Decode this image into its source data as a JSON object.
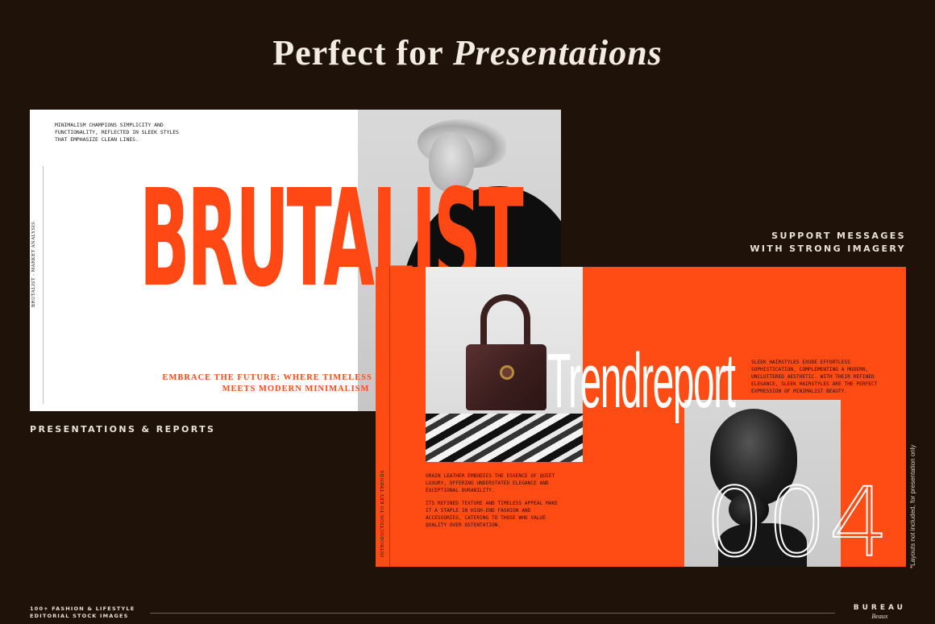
{
  "heading": {
    "plain": "Perfect for ",
    "italic": "Presentations"
  },
  "captions": {
    "left": "PRESENTATIONS & REPORTS",
    "right_line1": "SUPPORT MESSAGES",
    "right_line2": "WITH STRONG IMAGERY"
  },
  "slide1": {
    "intro": "MINIMALISM CHAMPIONS SIMPLICITY AND FUNCTIONALITY, REFLECTED IN SLEEK STYLES THAT EMPHASIZE CLEAN LINES.",
    "title": "BRUTALIST",
    "tagline_line1": "EMBRACE THE FUTURE: WHERE TIMELESS ELEGANCE",
    "tagline_line2": "MEETS MODERN MINIMALISM",
    "vertical_label": "BRUTALIST - MARKET ANALYSIS"
  },
  "slide2": {
    "title": "Trendreport",
    "description": "SLEEK HAIRSTYLES EXUDE EFFORTLESS SOPHISTICATION, COMPLEMENTING A MODERN, UNCLUTTERED AESTHETIC. WITH THEIR REFINED ELEGANCE, SLEEK HAIRSTYLES ARE THE PERFECT EXPRESSION OF MINIMALIST BEAUTY.",
    "body_p1": "GRAIN LEATHER EMBODIES THE ESSENCE OF QUIET LUXURY, OFFERING UNDERSTATED ELEGANCE AND EXCEPTIONAL DURABILITY.",
    "body_p2": "ITS REFINED TEXTURE AND TIMELESS APPEAL MAKE IT A STAPLE IN HIGH-END FASHION AND ACCESSORIES, CATERING TO THOSE WHO VALUE QUALITY OVER OSTENTATION.",
    "number": "004",
    "vertical_label": "INTRODUCTION TO KEY TRENDS"
  },
  "side_note": "*Layouts not included, for presentation only",
  "footer": {
    "left_line1": "100+ FASHION & LIFESTYLE",
    "left_line2": "EDITORIAL STOCK IMAGES",
    "brand": "BUREAU",
    "brand_sub": "Beaux"
  },
  "colors": {
    "background": "#1f1209",
    "accent": "#ff4814",
    "text_light": "#f4ece3"
  },
  "icons": []
}
